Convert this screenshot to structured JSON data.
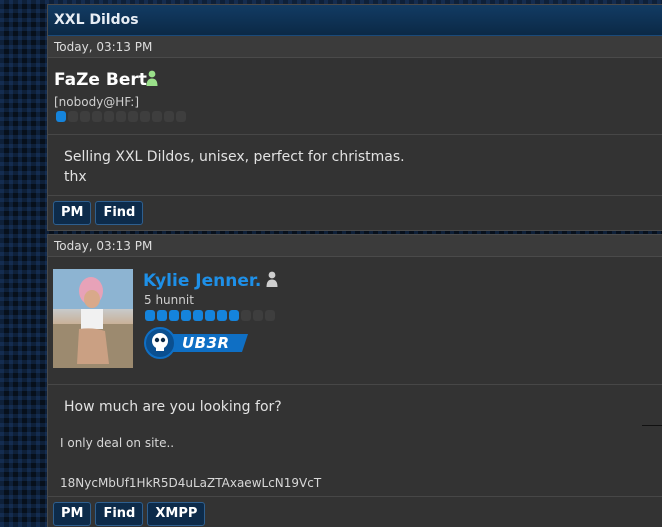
{
  "thread": {
    "title": "XXL Dildos"
  },
  "posts": [
    {
      "date": "Today, 03:13 PM",
      "username": "FaZe Bert",
      "usertitle": "[nobody@HF:]",
      "reputation": {
        "filled": 1,
        "total": 11
      },
      "body": [
        "Selling XXL Dildos, unisex, perfect for christmas.",
        "thx"
      ],
      "buttons": [
        "PM",
        "Find"
      ]
    },
    {
      "date": "Today, 03:13 PM",
      "username": "Kylie Jenner.",
      "usertitle": "5 hunnit",
      "reputation": {
        "filled": 8,
        "total": 11
      },
      "badge_label": "UB3R",
      "body": [
        "How much are you looking for?"
      ],
      "signature": [
        "I only deal on site..",
        "18NycMbUf1HkR5D4uLaZTAxaewLcN19VcT"
      ],
      "buttons": [
        "PM",
        "Find",
        "XMPP"
      ]
    }
  ],
  "colors": {
    "header_bg": "#0b2946",
    "panel_bg": "#333333",
    "username_accent": "#1e90e8",
    "rep_on": "#1584dc",
    "button_bg": "#0d2b4a"
  },
  "icons": {
    "online": "user-online-icon",
    "badge": "skull-badge-icon"
  }
}
